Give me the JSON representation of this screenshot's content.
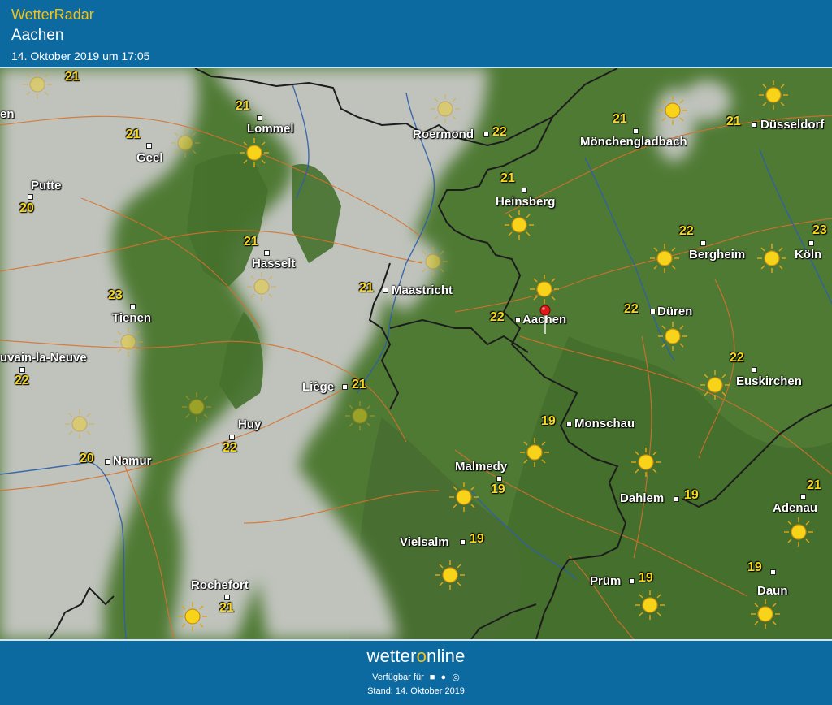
{
  "header": {
    "brand": "WetterRadar",
    "location": "Aachen",
    "timestamp": "14. Oktober 2019 um 17:05"
  },
  "colors": {
    "header_bg": "#0d6aa0",
    "brand": "#f3c21b",
    "temp": "#f7d81b",
    "land": "#4f7a34",
    "cloud": "#bfc3bc"
  },
  "map": {
    "selected_location": "Aachen",
    "icons": [
      "sun-icon",
      "location-pin-icon"
    ],
    "stations": [
      {
        "name": "",
        "temp": "21"
      },
      {
        "name": "Lommel",
        "temp": "21"
      },
      {
        "name": "Geel",
        "temp": "21"
      },
      {
        "name": "Putte",
        "temp": "20"
      },
      {
        "name": "Roermond",
        "temp": "22"
      },
      {
        "name": "Mönchengladbach",
        "temp": "21"
      },
      {
        "name": "Düsseldorf",
        "temp": "21"
      },
      {
        "name": "Heinsberg",
        "temp": "21"
      },
      {
        "name": "Hasselt",
        "temp": "21"
      },
      {
        "name": "Bergheim",
        "temp": "22"
      },
      {
        "name": "Köln",
        "temp": "23"
      },
      {
        "name": "Maastricht",
        "temp": "21"
      },
      {
        "name": "Tienen",
        "temp": "23"
      },
      {
        "name": "Aachen",
        "temp": "22"
      },
      {
        "name": "Düren",
        "temp": "22"
      },
      {
        "name": "uvain-la-Neuve",
        "temp": "22"
      },
      {
        "name": "Euskirchen",
        "temp": "22"
      },
      {
        "name": "Liège",
        "temp": "21"
      },
      {
        "name": "Huy",
        "temp": "22"
      },
      {
        "name": "Monschau",
        "temp": "19"
      },
      {
        "name": "Namur",
        "temp": "20"
      },
      {
        "name": "Malmedy",
        "temp": "19"
      },
      {
        "name": "Dahlem",
        "temp": "19"
      },
      {
        "name": "Adenau",
        "temp": "21"
      },
      {
        "name": "Vielsalm",
        "temp": "19"
      },
      {
        "name": "Prüm",
        "temp": "19"
      },
      {
        "name": "Daun",
        "temp": "19"
      },
      {
        "name": "Rochefort",
        "temp": "21"
      }
    ],
    "cut_off_label": "en"
  },
  "footer": {
    "logo_a": "wetter",
    "logo_b": "o",
    "logo_c": "nline",
    "available": "Verfügbar für",
    "os_icons": [
      "android-icon",
      "apple-icon",
      "web-icon"
    ],
    "stand": "Stand: 14. Oktober 2019"
  }
}
